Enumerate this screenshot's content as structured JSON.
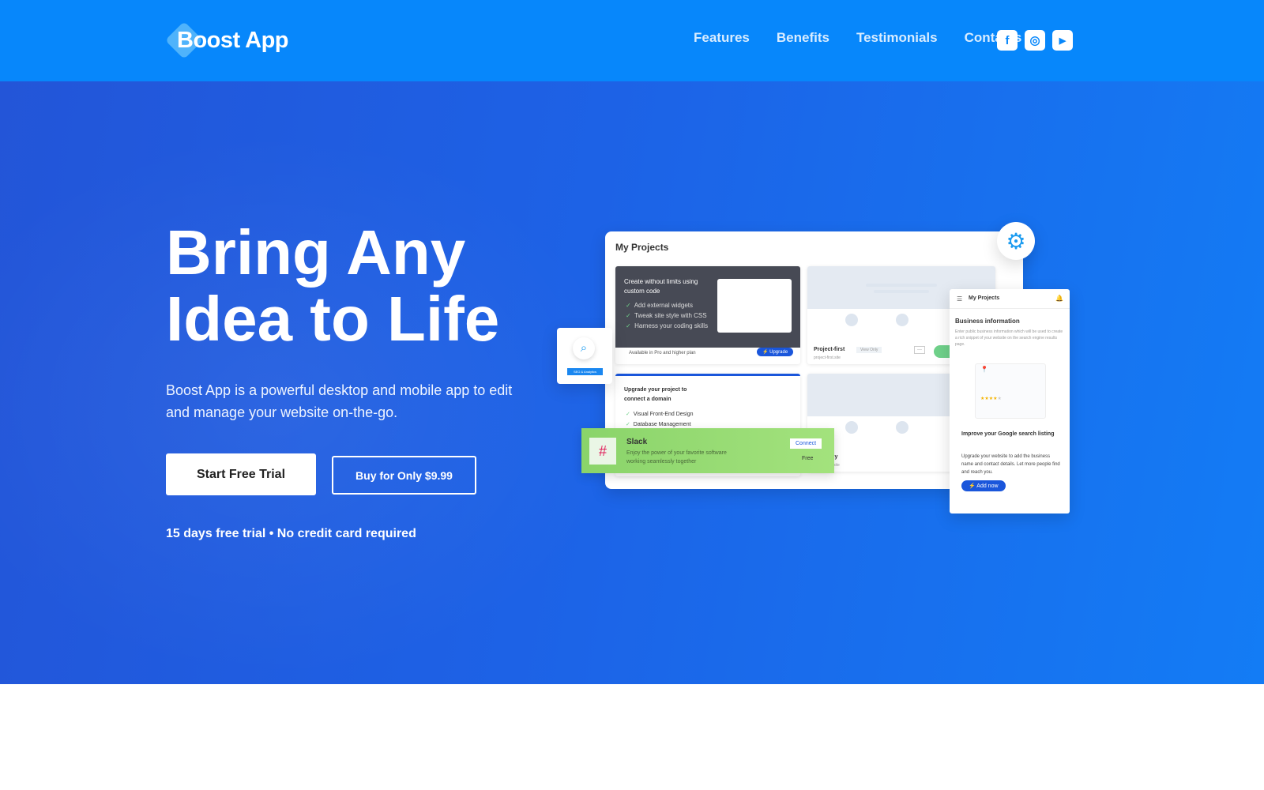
{
  "nav": {
    "logo": "Boost App",
    "links": [
      "Features",
      "Benefits",
      "Testimonials",
      "Contacts"
    ],
    "social": [
      {
        "icon": "facebook-icon",
        "glyph": "f"
      },
      {
        "icon": "instagram-icon",
        "glyph": "◎"
      },
      {
        "icon": "youtube-icon",
        "glyph": "▶"
      }
    ]
  },
  "hero": {
    "title_line1": "Bring Any",
    "title_line2": "Idea to Life",
    "subtitle": "Boost App is a powerful desktop and mobile app to edit and manage your website on-the-go.",
    "primary_button": "Start Free Trial",
    "secondary_button": "Buy for Only $9.99",
    "note": "15 days free trial • No credit card required"
  },
  "mockup": {
    "title": "My Projects",
    "dark_card": {
      "heading": "Create without limits using custom code",
      "items": [
        "Add external widgets",
        "Tweak site style with CSS",
        "Harness your coding skills"
      ],
      "footer": "Available in Pro and higher plan",
      "button": "Upgrade"
    },
    "project1": {
      "name": "Project-first",
      "badge": "View Only",
      "url": "project-first.site",
      "more": "···"
    },
    "domain_card": {
      "heading": "Upgrade your project to connect a domain",
      "items": [
        "Visual Front-End Design",
        "Database Management"
      ]
    },
    "project2": {
      "name": "ogy",
      "url": "rst.site"
    },
    "seo": {
      "label": "SEO & Analytics"
    },
    "slack": {
      "name": "Slack",
      "desc": "Enjoy the power of your favorite software working seamlessly together",
      "button": "Connect",
      "price": "Free"
    },
    "mobile": {
      "title": "My Projects",
      "heading": "Business information",
      "desc": "Enter public business information which will be used to create a rich snippet of your website on the search engine results page.",
      "promo_title": "Improve your Google search listing",
      "promo_desc": "Upgrade your website to add the business name and contact details. Let more people find and reach you.",
      "button": "Add now"
    }
  },
  "colors": {
    "nav": "#0787fb",
    "accent": "#1a56db",
    "slack_green": "#8ddc6a"
  }
}
